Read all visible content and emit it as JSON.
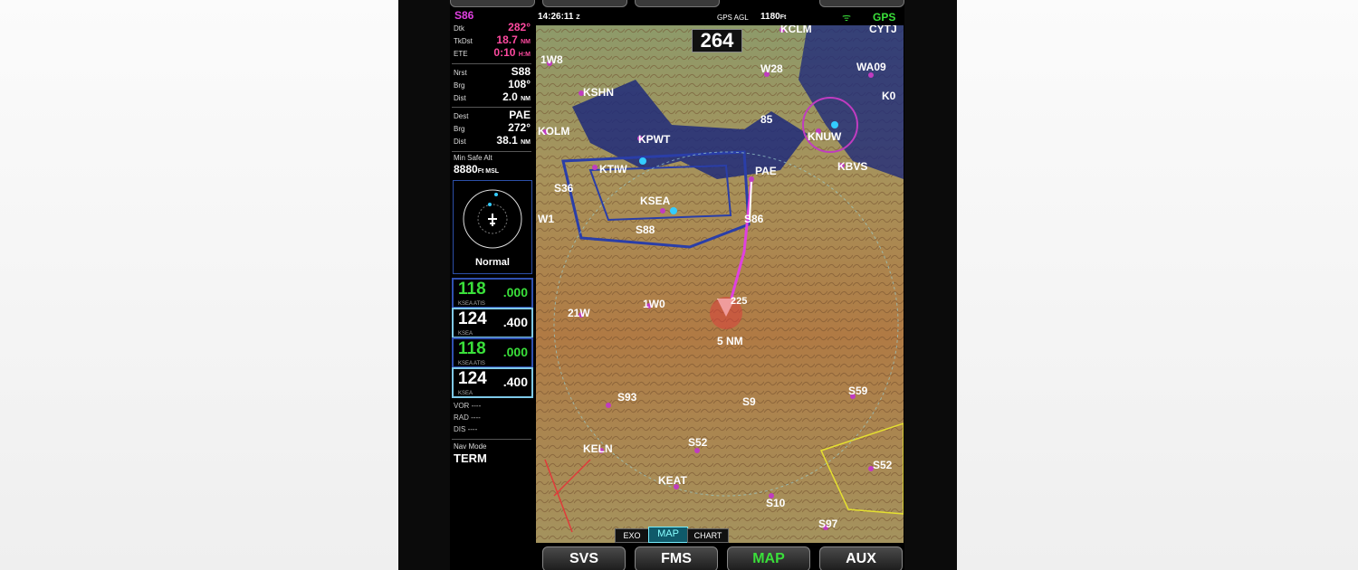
{
  "status": {
    "time": "14:26:11",
    "time_zone": "Z",
    "gps_agl_label": "GPS AGL",
    "gps_agl_value": "1180",
    "gps_agl_unit": "Ft",
    "gps": "GPS"
  },
  "side": {
    "wpt": "S86",
    "rows": [
      {
        "label": "Dtk",
        "value": "282°",
        "unit": "",
        "color": "pink"
      },
      {
        "label": "TkDst",
        "value": "18.7",
        "unit": "NM",
        "color": "pink"
      },
      {
        "label": "ETE",
        "value": "0:10",
        "unit": "H:M",
        "color": "pink"
      },
      {
        "label": "Nrst",
        "value": "S88",
        "unit": "",
        "color": "white"
      },
      {
        "label": "Brg",
        "value": "108°",
        "unit": "",
        "color": "white"
      },
      {
        "label": "Dist",
        "value": "2.0",
        "unit": "NM",
        "color": "white"
      },
      {
        "label": "Dest",
        "value": "PAE",
        "unit": "",
        "color": "white"
      },
      {
        "label": "Brg",
        "value": "272°",
        "unit": "",
        "color": "white"
      },
      {
        "label": "Dist",
        "value": "38.1",
        "unit": "NM",
        "color": "white"
      }
    ],
    "msa_label": "Min Safe Alt",
    "msa_value": "8880",
    "msa_unit": "Ft MSL",
    "traffic_mode": "Normal",
    "freqs": [
      {
        "active": "118",
        "standby": "000",
        "id": "KSEA ATIS",
        "color": "green"
      },
      {
        "active": "124",
        "standby": "400",
        "id": "KSEA",
        "color": "white"
      },
      {
        "active": "118",
        "standby": "000",
        "id": "KSEA ATIS",
        "color": "green"
      },
      {
        "active": "124",
        "standby": "400",
        "id": "KSEA",
        "color": "white"
      }
    ],
    "vor_label": "VOR",
    "rad_label": "RAD",
    "dis_label": "DIS",
    "dash": "----",
    "nav_mode_label": "Nav Mode",
    "nav_mode": "TERM"
  },
  "map": {
    "heading": "264",
    "airports": [
      {
        "id": "KOLM"
      },
      {
        "id": "KSHN"
      },
      {
        "id": "KPWT"
      },
      {
        "id": "KTIW"
      },
      {
        "id": "KSEA"
      },
      {
        "id": "PAE"
      },
      {
        "id": "KNUW"
      },
      {
        "id": "KBVS"
      },
      {
        "id": "KELN"
      },
      {
        "id": "KEAT"
      },
      {
        "id": "KCLM"
      },
      {
        "id": "WA09"
      },
      {
        "id": "S86"
      },
      {
        "id": "S88"
      },
      {
        "id": "S93"
      },
      {
        "id": "S52"
      },
      {
        "id": "S10"
      },
      {
        "id": "S97"
      },
      {
        "id": "S59"
      },
      {
        "id": "S52"
      }
    ],
    "labels": [
      "1W8",
      "W28",
      "85",
      "W1",
      "S36",
      "21W",
      "1W0",
      "S9",
      "CYTJ",
      "K0"
    ],
    "range_ring": "5 NM",
    "ownship_alt": "225"
  },
  "tabs": [
    "EXO",
    "MAP",
    "CHART"
  ],
  "softkeys": [
    {
      "label": "SVS",
      "color": "#ffffff"
    },
    {
      "label": "FMS",
      "color": "#ffffff"
    },
    {
      "label": "MAP",
      "color": "#3adf3a"
    },
    {
      "label": "AUX",
      "color": "#ffffff"
    }
  ],
  "colors": {
    "pink": "#ff4aa0",
    "green": "#3adf3a",
    "magenta_route": "#e040e0",
    "airspace_blue": "#2a3ea8"
  }
}
